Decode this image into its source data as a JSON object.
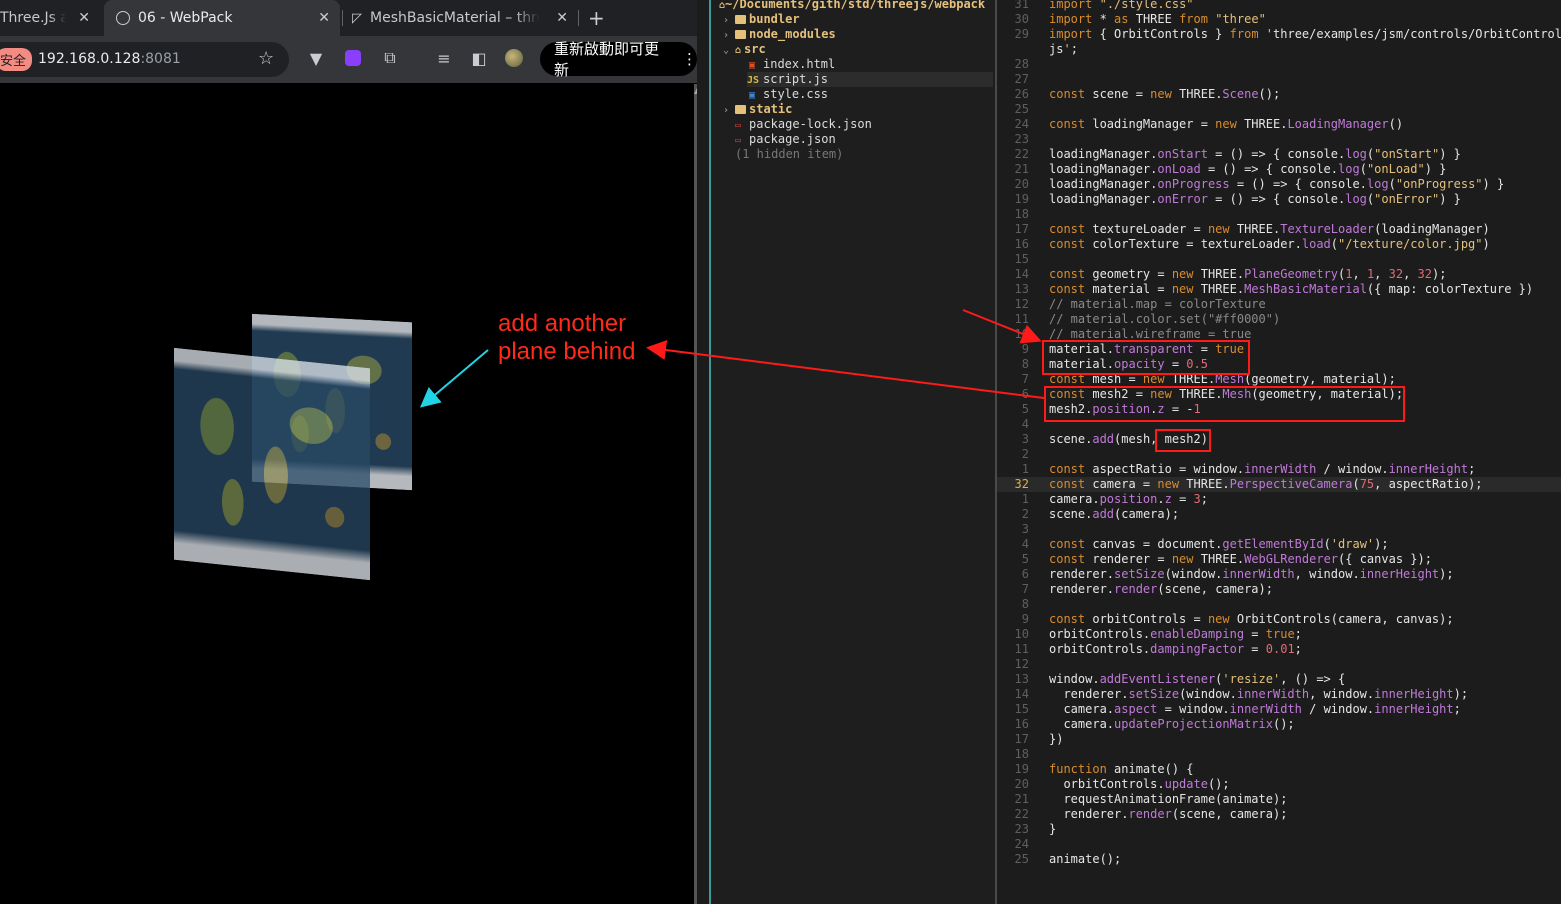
{
  "browser": {
    "tabs": [
      {
        "title": "Three.Js a",
        "close": "✕"
      },
      {
        "title": "06 - WebPack",
        "close": "✕"
      },
      {
        "title": "MeshBasicMaterial – three",
        "close": "✕"
      }
    ],
    "new_tab": "+",
    "security_chip": "安全",
    "url_host": "192.168.0.128",
    "url_port": ":8081",
    "update_button": "重新啟動即可更新",
    "update_menu": "⋮",
    "annotation": {
      "line1": "add another",
      "line2": "plane behind"
    }
  },
  "filetree": {
    "root": "~/Documents/gith/std/threejs/webpack",
    "items": [
      {
        "label": "bundler",
        "kind": "dir",
        "arrow": "›"
      },
      {
        "label": "node_modules",
        "kind": "dir",
        "arrow": "›"
      },
      {
        "label": "src",
        "kind": "dir",
        "arrow": "⌄"
      },
      {
        "label": "index.html",
        "kind": "html"
      },
      {
        "label": "script.js",
        "kind": "js"
      },
      {
        "label": "style.css",
        "kind": "css"
      },
      {
        "label": "static",
        "kind": "dir",
        "arrow": "›"
      },
      {
        "label": "package-lock.json",
        "kind": "json"
      },
      {
        "label": "package.json",
        "kind": "json"
      },
      {
        "label": "(1 hidden item)",
        "kind": "hidden"
      }
    ]
  },
  "editor": {
    "line_numbers": [
      "31",
      "30",
      "29",
      "",
      "28",
      "27",
      "26",
      "25",
      "24",
      "23",
      "22",
      "21",
      "20",
      "19",
      "18",
      "17",
      "16",
      "15",
      "14",
      "13",
      "12",
      "11",
      "10",
      "9",
      "8",
      "7",
      "6",
      "5",
      "4",
      "3",
      "2",
      "1",
      "32",
      "1",
      "2",
      "3",
      "4",
      "5",
      "6",
      "7",
      "8",
      "9",
      "10",
      "11",
      "12",
      "13",
      "14",
      "15",
      "16",
      "17",
      "18",
      "19",
      "20",
      "21",
      "22",
      "23",
      "24",
      "25"
    ],
    "lines": [
      "import \"./style.css\"",
      "import * as THREE from \"three\"",
      "import { OrbitControls } from 'three/examples/jsm/controls/OrbitControls.",
      "js';",
      "",
      "",
      "const scene = new THREE.Scene();",
      "",
      "const loadingManager = new THREE.LoadingManager()",
      "",
      "loadingManager.onStart = () => { console.log(\"onStart\") }",
      "loadingManager.onLoad = () => { console.log(\"onLoad\") }",
      "loadingManager.onProgress = () => { console.log(\"onProgress\") }",
      "loadingManager.onError = () => { console.log(\"onError\") }",
      "",
      "const textureLoader = new THREE.TextureLoader(loadingManager)",
      "const colorTexture = textureLoader.load(\"/texture/color.jpg\")",
      "",
      "const geometry = new THREE.PlaneGeometry(1, 1, 32, 32);",
      "const material = new THREE.MeshBasicMaterial({ map: colorTexture })",
      "// material.map = colorTexture",
      "// material.color.set(\"#ff0000\")",
      "// material.wireframe = true",
      "material.transparent = true",
      "material.opacity = 0.5",
      "const mesh = new THREE.Mesh(geometry, material);",
      "const mesh2 = new THREE.Mesh(geometry, material);",
      "mesh2.position.z = -1",
      "",
      "scene.add(mesh, mesh2)",
      "",
      "const aspectRatio = window.innerWidth / window.innerHeight;",
      "const camera = new THREE.PerspectiveCamera(75, aspectRatio);",
      "camera.position.z = 3;",
      "scene.add(camera);",
      "",
      "const canvas = document.getElementById('draw');",
      "const renderer = new THREE.WebGLRenderer({ canvas });",
      "renderer.setSize(window.innerWidth, window.innerHeight);",
      "renderer.render(scene, camera);",
      "",
      "const orbitControls = new OrbitControls(camera, canvas);",
      "orbitControls.enableDamping = true;",
      "orbitControls.dampingFactor = 0.01;",
      "",
      "window.addEventListener('resize', () => {",
      "  renderer.setSize(window.innerWidth, window.innerHeight);",
      "  camera.aspect = window.innerWidth / window.innerHeight;",
      "  camera.updateProjectionMatrix();",
      "})",
      "",
      "function animate() {",
      "  orbitControls.update();",
      "  requestAnimationFrame(animate);",
      "  renderer.render(scene, camera);",
      "}",
      "",
      "animate();"
    ],
    "current_line_index": 32
  },
  "colors": {
    "annotation_red": "#ff1a1a",
    "annotation_cyan": "#22d3e6",
    "keyword": "#d98c2e",
    "string": "#e5c07b",
    "property": "#c07ad8"
  }
}
